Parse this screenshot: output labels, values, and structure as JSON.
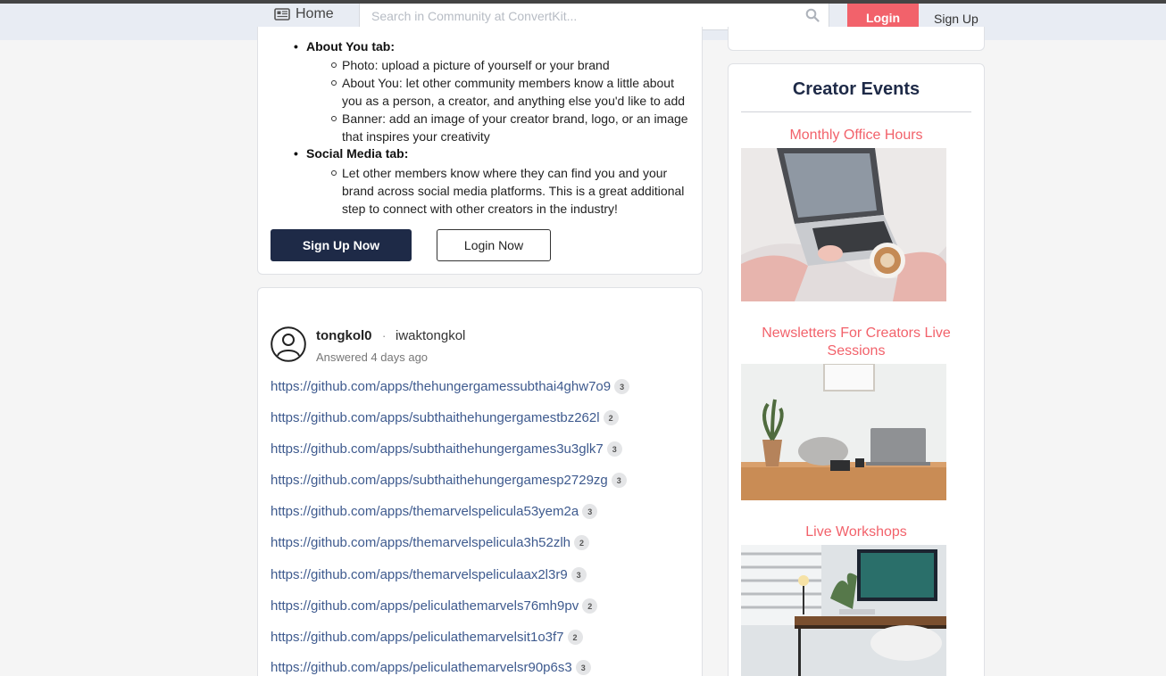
{
  "nav": {
    "home_label": "Home",
    "search_placeholder": "Search in Community at ConvertKit...",
    "login_label": "Login",
    "signup_label": "Sign Up"
  },
  "instructions": {
    "about_tab": "About You tab:",
    "about_items": [
      "Photo: upload a picture of yourself or your brand",
      "About You: let other community members know a little about you as a person, a creator, and anything else you'd like to add",
      "Banner: add an image of your creator brand, logo, or an image that inspires your creativity"
    ],
    "social_tab": "Social Media tab:",
    "social_items": [
      "Let other members know where they can find you and your brand across social media platforms. This is a great additional step to connect with other creators in the industry!"
    ],
    "signup_now": "Sign Up Now",
    "login_now": "Login Now"
  },
  "answer": {
    "username": "tongkol0",
    "separator": "·",
    "alias": "iwaktongkol",
    "answered": "Answered 4 days ago",
    "links": [
      {
        "url": "https://github.com/apps/thehungergamessubthai4ghw7o9",
        "count": "3"
      },
      {
        "url": "https://github.com/apps/subthaithehungergamestbz262l",
        "count": "2"
      },
      {
        "url": "https://github.com/apps/subthaithehungergames3u3glk7",
        "count": "3"
      },
      {
        "url": "https://github.com/apps/subthaithehungergamesp2729zg",
        "count": "3"
      },
      {
        "url": "https://github.com/apps/themarvelspelicula53yem2a",
        "count": "3"
      },
      {
        "url": "https://github.com/apps/themarvelspelicula3h52zlh",
        "count": "2"
      },
      {
        "url": "https://github.com/apps/themarvelspeliculaax2l3r9",
        "count": "3"
      },
      {
        "url": "https://github.com/apps/peliculathemarvels76mh9pv",
        "count": "2"
      },
      {
        "url": "https://github.com/apps/peliculathemarvelsit1o3f7",
        "count": "2"
      },
      {
        "url": "https://github.com/apps/peliculathemarvelsr90p6s3",
        "count": "3"
      }
    ]
  },
  "sidebar": {
    "events_title": "Creator Events",
    "events": [
      {
        "title": "Monthly Office Hours"
      },
      {
        "title": "Newsletters For Creators Live Sessions"
      },
      {
        "title": "Live Workshops"
      }
    ]
  },
  "colors": {
    "accent": "#f2626b",
    "navy": "#1e2a47",
    "link": "#3e5a8e"
  }
}
